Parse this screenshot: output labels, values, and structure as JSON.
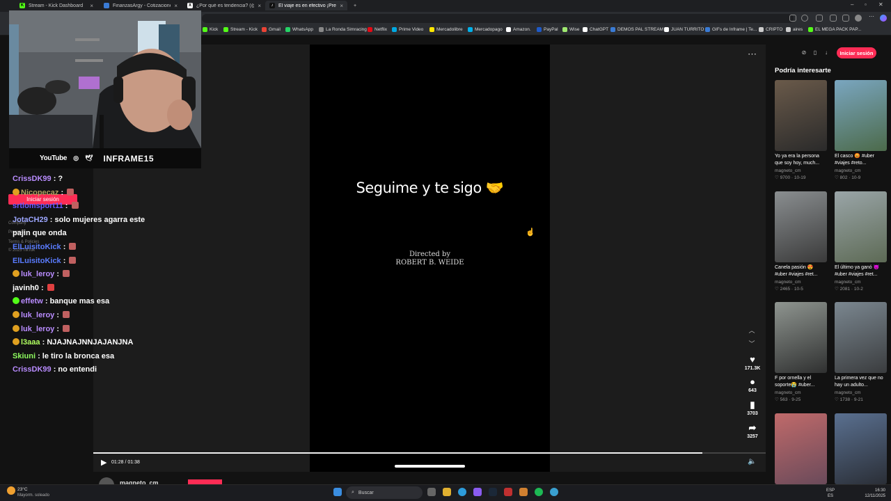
{
  "browser": {
    "tabs": [
      {
        "title": "Stream - Kick Dashboard",
        "active": false
      },
      {
        "title": "FinanzasArgy - Cotizaciones en ti...",
        "active": false
      },
      {
        "title": "¿Por qué es tendencia? (@porqu...",
        "active": false
      },
      {
        "title": "El viaje es en efectivo ¡Prepárate...",
        "active": true
      }
    ],
    "new_tab": "+",
    "bookmarks": [
      "Kick",
      "Stream - Kick",
      "Gmail",
      "WhatsApp",
      "La Ronda Simracing",
      "Netflix",
      "Prime Video",
      "Mercadolibre",
      "Mercadopago",
      "Amazon.",
      "PayPal",
      "Wise",
      "ChatGPT",
      "DEMOS PAL STREAM",
      "JUAN TURRITO",
      "GIFs de Inframe | Te...",
      "CRIPTO",
      "aires",
      "EL MEGA PACK PAP..."
    ]
  },
  "video": {
    "overlay_text": "Seguime y te sigo 🤝",
    "credit_line1": "Directed by",
    "credit_line2": "ROBERT B. WEIDE",
    "time": "01:28 / 01:38",
    "progress": 0.906,
    "likes": "171.3K",
    "comments": "643",
    "saves": "3703",
    "shares": "3257",
    "author": "magneto_cm"
  },
  "right": {
    "login": "Iniciar sesión",
    "title": "Podría interesarte",
    "cards": [
      {
        "caption": "Yo ya era la persona que soy hoy, much...",
        "author": "magneto_cm",
        "likes": "9700",
        "date": "10-19",
        "c1": "#6a5a4a",
        "c2": "#2a2a2a"
      },
      {
        "caption": "El casco 😡 #uber #viajes #reto...",
        "author": "magneto_cm",
        "likes": "802",
        "date": "10-9",
        "c1": "#7aa6c0",
        "c2": "#4c6a4a"
      },
      {
        "caption": "Canela pasión 😍 #uber #viajes #ret...",
        "author": "magneto_cm",
        "likes": "2465",
        "date": "10-5",
        "c1": "#8a8e90",
        "c2": "#3a3a3a"
      },
      {
        "caption": "El último ya ganó 😈 #uber #viajes #ret...",
        "author": "magneto_cm",
        "likes": "2081",
        "date": "10-2",
        "c1": "#9aa5a8",
        "c2": "#5d6a55"
      },
      {
        "caption": "F por ornella y el soporte😭 #uber...",
        "author": "magneto_cm",
        "likes": "563",
        "date": "9-25",
        "c1": "#8f9590",
        "c2": "#2f3030"
      },
      {
        "caption": "La primera vez que no hay un adulto...",
        "author": "magneto_cm",
        "likes": "1738",
        "date": "9-21",
        "c1": "#7b8790",
        "c2": "#3a3c3e"
      },
      {
        "caption": "",
        "author": "",
        "likes": "",
        "date": "",
        "c1": "#c06a6a",
        "c2": "#6a4a5a"
      },
      {
        "caption": "",
        "author": "",
        "likes": "",
        "date": "",
        "c1": "#5a7090",
        "c2": "#2a2e36"
      }
    ]
  },
  "stream": {
    "social_youtube": "YouTube",
    "handle": "INFRAME15",
    "chat": [
      {
        "user": "CrissDK99",
        "msg": "?",
        "color": "#b98cff",
        "badge": ""
      },
      {
        "user": "Nicopecaz",
        "msg": "",
        "color": "#b0a060",
        "badge": "#e0a020"
      },
      {
        "user": "srtlomsport11",
        "msg": "",
        "color": "#6a5cff",
        "badge": ""
      },
      {
        "user": "JotaCH29",
        "msg": "solo mujeres agarra este",
        "color": "#9da7ff",
        "badge": ""
      },
      {
        "user": "",
        "msg": "pajin que onda",
        "color": "#ffffff",
        "badge": ""
      },
      {
        "user": "ElLuisitoKick",
        "msg": "",
        "color": "#5a7cff",
        "badge": ""
      },
      {
        "user": "ElLuisitoKick",
        "msg": "",
        "color": "#5a7cff",
        "badge": ""
      },
      {
        "user": "luk_leroy",
        "msg": "",
        "color": "#b98cff",
        "badge": "#e0a020"
      },
      {
        "user": "javinh0",
        "msg": "",
        "color": "#ffffff",
        "badge": ""
      },
      {
        "user": "effetw",
        "msg": "banque mas esa",
        "color": "#b98cff",
        "badge": "#53fc18"
      },
      {
        "user": "luk_leroy",
        "msg": "",
        "color": "#b98cff",
        "badge": "#e0a020"
      },
      {
        "user": "luk_leroy",
        "msg": "",
        "color": "#b98cff",
        "badge": "#e0a020"
      },
      {
        "user": "l3aaa",
        "msg": "NJAJNAJNNJAJANJNA",
        "color": "#b0ff60",
        "badge": "#e0a020"
      },
      {
        "user": "Skiuni",
        "msg": "le tiro la bronca esa",
        "color": "#90ff60",
        "badge": ""
      },
      {
        "user": "CrissDK99",
        "msg": "no entendi",
        "color": "#b98cff",
        "badge": ""
      }
    ],
    "left_login": "Iniciar sesión",
    "faint": [
      "Company",
      "Program",
      "Terms & Policies",
      "© 2025 TikTok"
    ]
  },
  "taskbar": {
    "temp": "23°C",
    "weather": "Mayorm. soleado",
    "search": "Buscar",
    "lang1": "ESP",
    "lang2": "ES",
    "time": "16:30",
    "date": "12/11/2025"
  }
}
